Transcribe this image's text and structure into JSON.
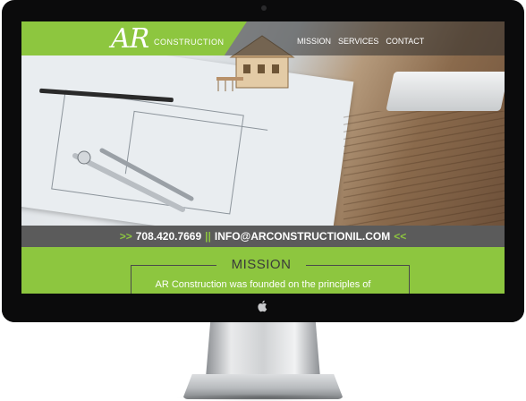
{
  "header": {
    "logo_main": "AR",
    "logo_sub": "CONSTRUCTION",
    "nav": [
      "MISSION",
      "SERVICES",
      "CONTACT"
    ]
  },
  "contact": {
    "chev_left": ">>",
    "phone": "708.420.7669",
    "separator": "||",
    "email": "INFO@ARCONSTRUCTIONIL.COM",
    "chev_right": "<<"
  },
  "mission": {
    "title": "MISSION",
    "text": "AR Construction was founded on the principles of"
  },
  "colors": {
    "accent": "#8dc63f",
    "bar": "#5b5b5b",
    "bezel": "#0b0b0c"
  },
  "icons": [
    "apple-icon",
    "camera-icon"
  ]
}
